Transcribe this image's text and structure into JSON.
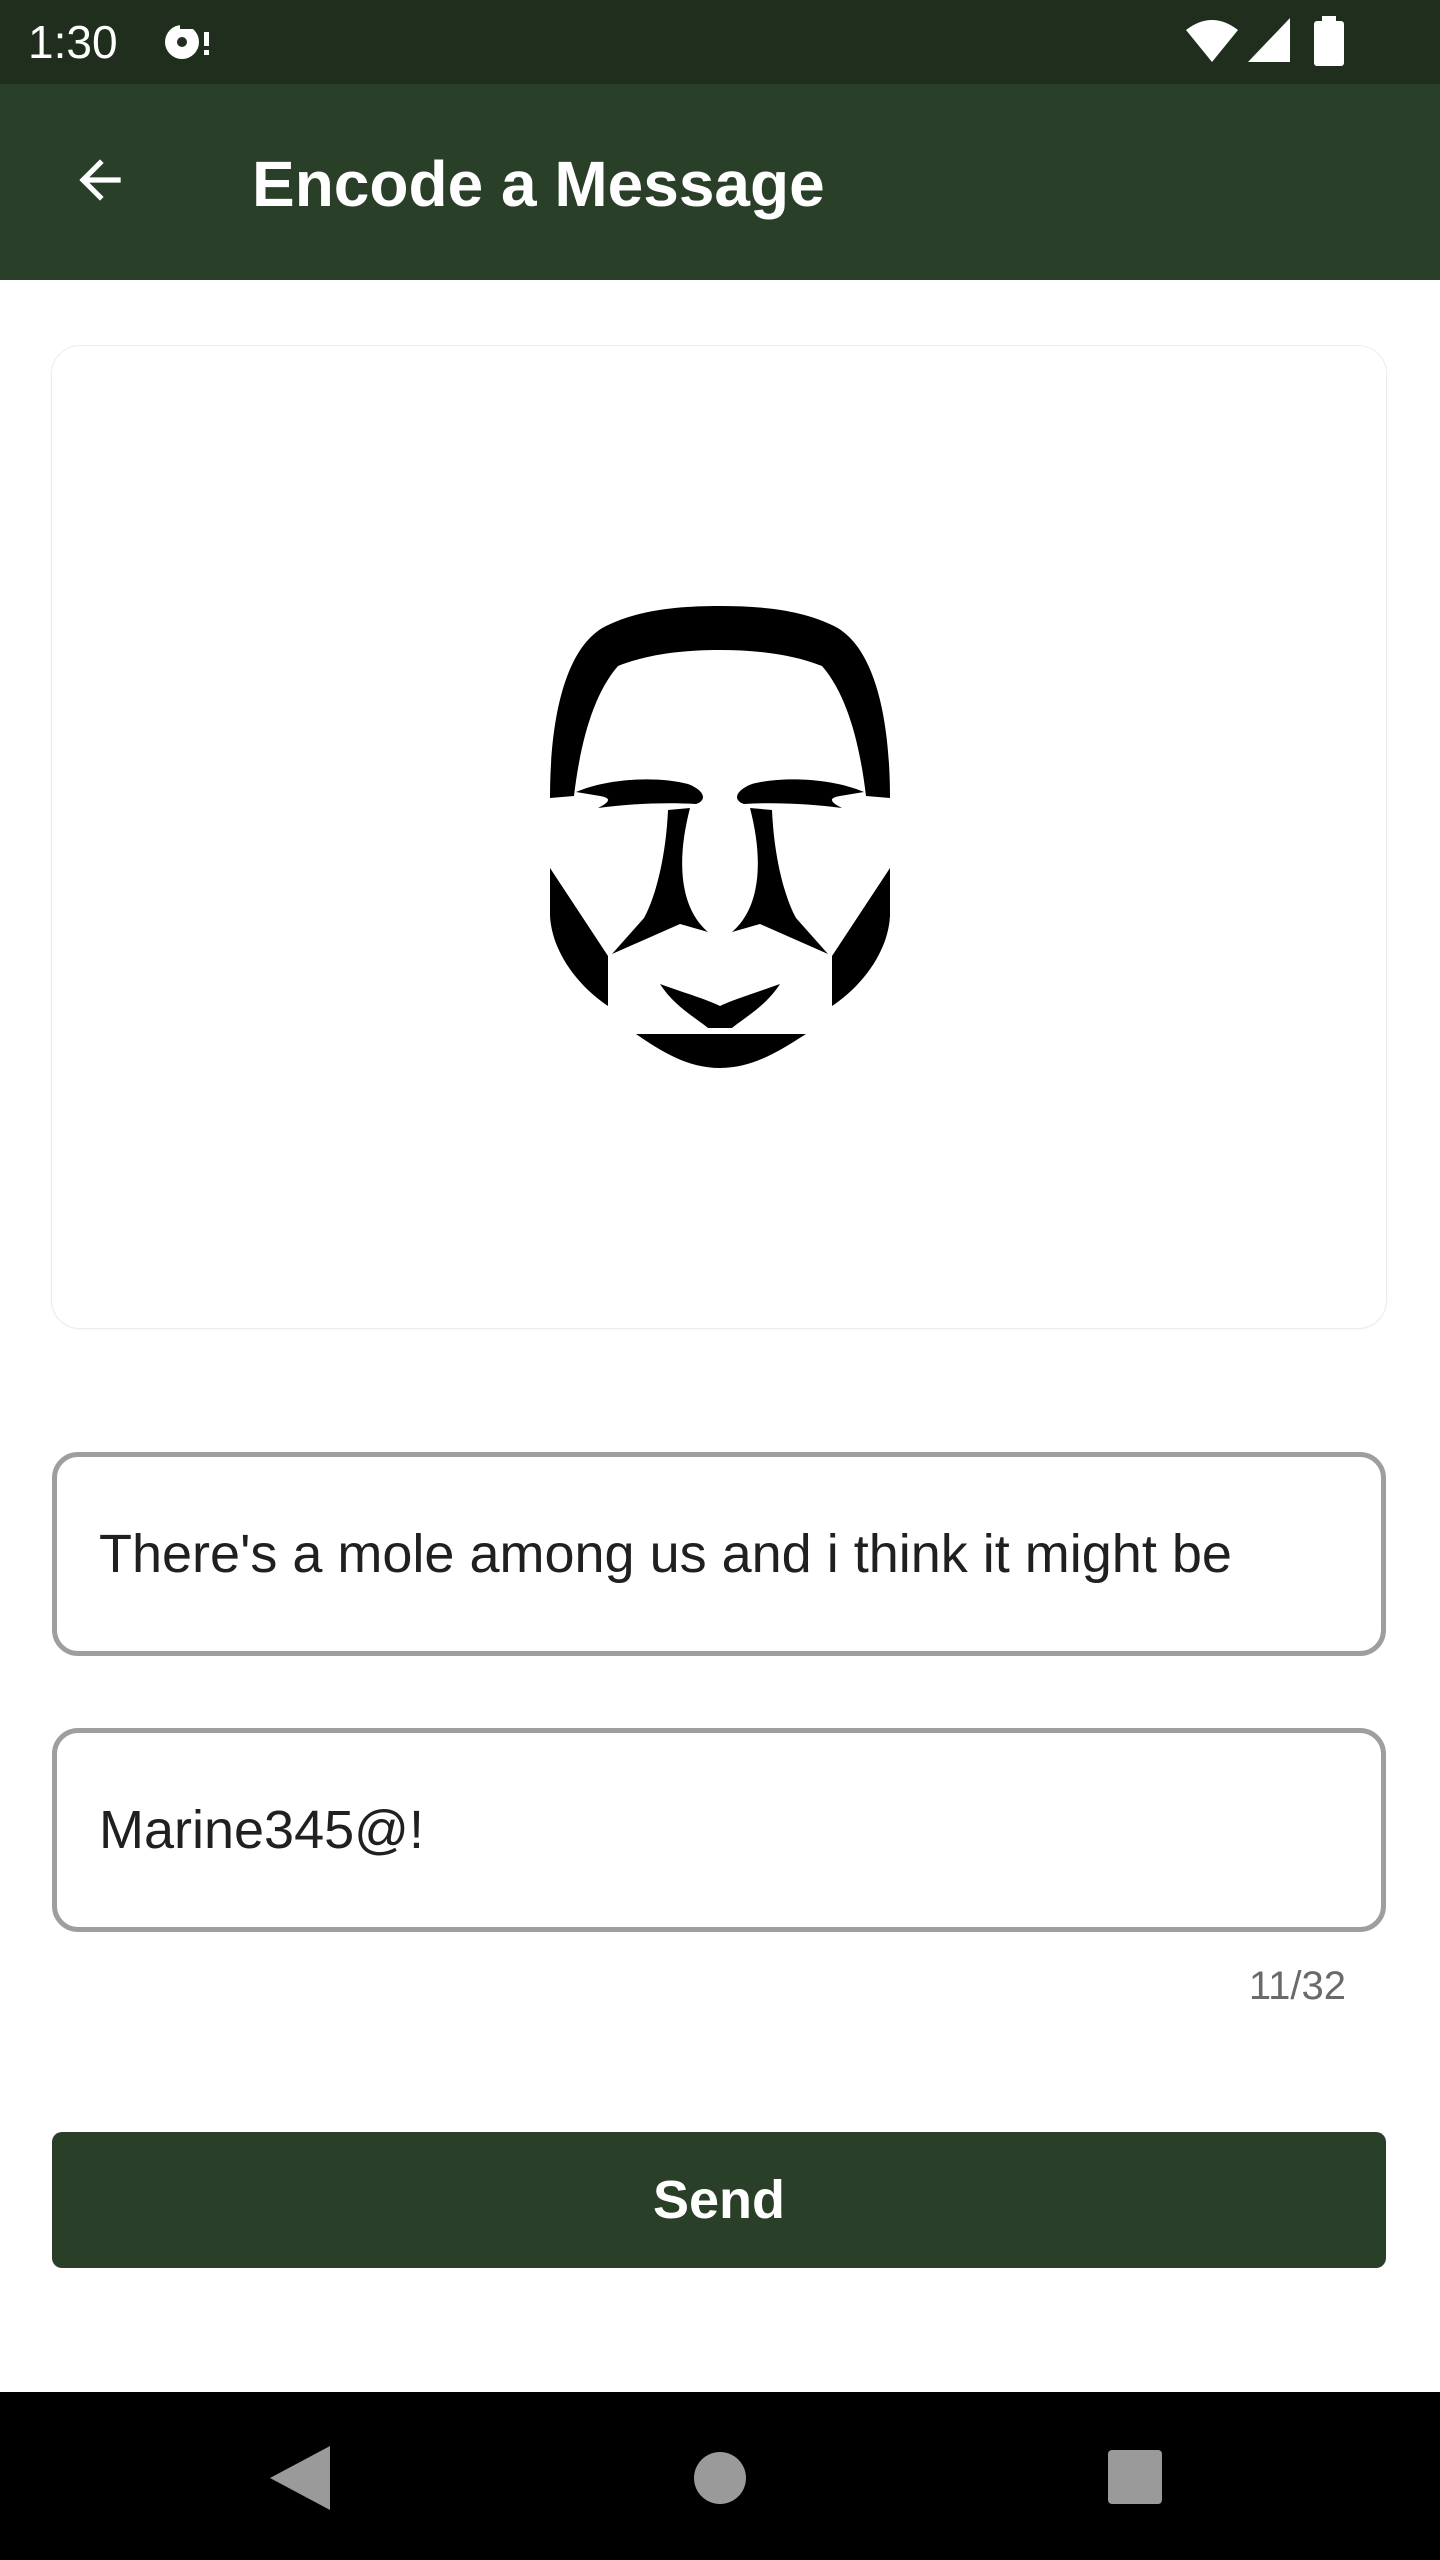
{
  "status_bar": {
    "time": "1:30",
    "icons": [
      "notification-icon",
      "wifi-icon",
      "signal-icon",
      "battery-icon"
    ]
  },
  "app_bar": {
    "title": "Encode a Message",
    "back_icon": "arrow-back-icon"
  },
  "image_card": {
    "image_icon": "face-logo"
  },
  "form": {
    "message_value": "There's a mole among us and i think it might be",
    "password_value": "Marine345@!",
    "char_counter": "11/32",
    "send_label": "Send"
  },
  "nav_bar": {
    "icons": [
      "nav-back-icon",
      "nav-home-icon",
      "nav-recents-icon"
    ]
  },
  "colors": {
    "status_bar": "#1f2e1d",
    "app_bar": "#293f27",
    "button": "#293f27",
    "field_border": "#9e9e9e"
  }
}
